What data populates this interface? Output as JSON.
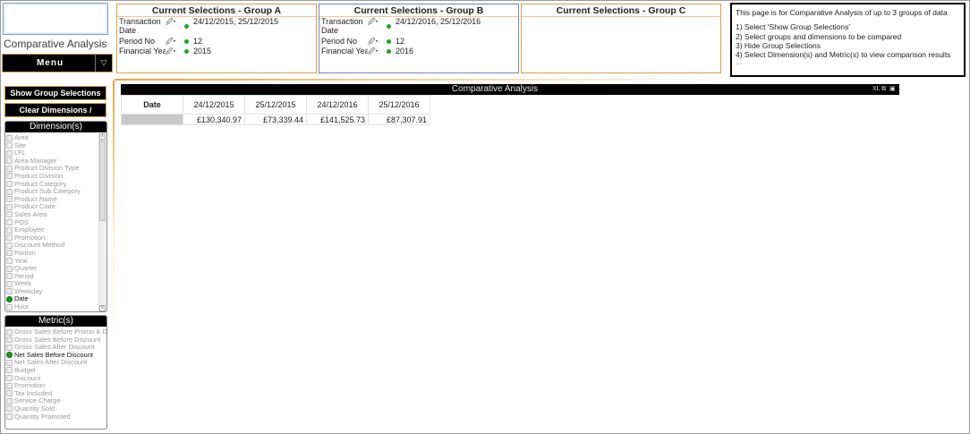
{
  "app": {
    "title": "Comparative Analysis"
  },
  "menu": {
    "label": "Menu",
    "arrow": "▽"
  },
  "buttons": {
    "show_groups": "Show Group Selections",
    "clear_dims": "Clear Dimensions / Metrics"
  },
  "dimensions": {
    "title": "Dimension(s)",
    "items": [
      "Area",
      "Site",
      "LFL",
      "Area Manager",
      "Product Division Type",
      "Product Division",
      "Product Category",
      "Product Sub Category",
      "Product Name",
      "Product Code",
      "Sales Area",
      "POS",
      "Employee",
      "Promotion",
      "Discount Method",
      "Portion",
      "Year",
      "Quarter",
      "Period",
      "Week",
      "Weekday",
      "Date",
      "Hour"
    ],
    "selected": "Date"
  },
  "metrics": {
    "title": "Metric(s)",
    "items": [
      "Gross Sales Before Promo & Dis",
      "Gross Sales Before Discount",
      "Gross Sales After Discount",
      "Net Sales Before Discount",
      "Net Sales After Discount",
      "Budget",
      "Discount",
      "Promotion",
      "Tax Included",
      "Service Charge",
      "Quantity Sold",
      "Quantity Promoted"
    ],
    "selected": "Net Sales Before Discount"
  },
  "groups": [
    {
      "title": "Current Selections - Group A",
      "rows": [
        {
          "field": "Transaction",
          "field2": "Date",
          "value": "24/12/2015, 25/12/2015"
        },
        {
          "field": "Period No",
          "value": "12"
        },
        {
          "field": "Financial Year",
          "value": "2015"
        }
      ]
    },
    {
      "title": "Current Selections - Group B",
      "rows": [
        {
          "field": "Transaction",
          "field2": "Date",
          "value": "24/12/2016, 25/12/2016"
        },
        {
          "field": "Period No",
          "value": "12"
        },
        {
          "field": "Financial Year",
          "value": "2016"
        }
      ]
    },
    {
      "title": "Current Selections - Group C",
      "rows": []
    }
  ],
  "info": {
    "intro": "This page is for Comparative Analysis of up to 3 groups of data",
    "steps": [
      "1) Select 'Show Group Selections'",
      "2) Select groups and dimensions to be compared",
      "3) Hide Group Selections",
      "4) Select Dimension(s) and Metric(s) to view comparison results"
    ],
    "ellipsis": "..."
  },
  "chart": {
    "title": "Comparative Analysis",
    "toolbar": {
      "xl": "XL",
      "restore": "⧉",
      "close": "▣"
    },
    "dim_header": "Date",
    "columns": [
      "24/12/2015",
      "25/12/2015",
      "24/12/2016",
      "25/12/2016"
    ],
    "values": [
      "£130,340.97",
      "£73,339.44",
      "£141,525.73",
      "£87,307.91"
    ]
  }
}
